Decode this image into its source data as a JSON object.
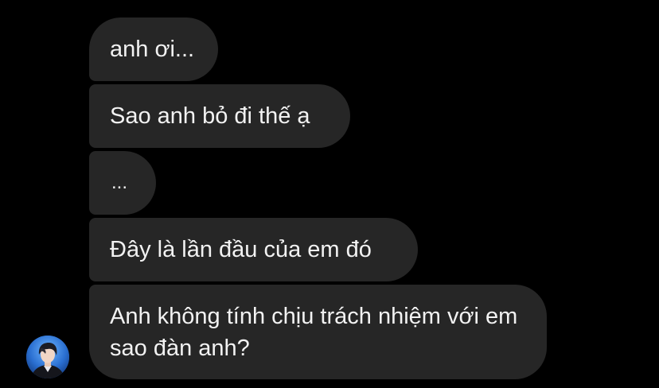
{
  "conversation": {
    "messages": [
      {
        "text": "anh ơi..."
      },
      {
        "text": "Sao anh bỏ đi thế ạ"
      },
      {
        "text": "..."
      },
      {
        "text": "Đây là lần đầu của em đó"
      },
      {
        "text": "Anh không tính chịu trách nhiệm với em sao đàn anh?"
      }
    ],
    "sender_avatar": {
      "icon": "profile-avatar-photo"
    }
  },
  "colors": {
    "background": "#000000",
    "bubble": "#262626",
    "text": "#f2f2f2"
  }
}
